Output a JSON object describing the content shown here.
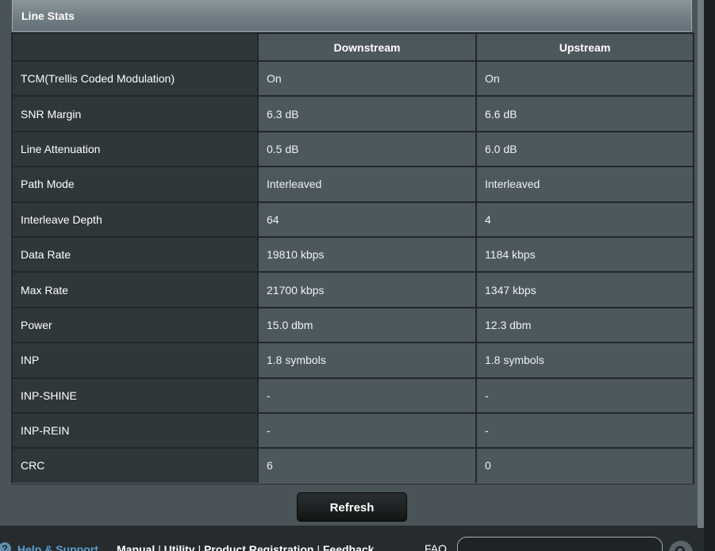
{
  "section": {
    "title": "Line Stats"
  },
  "table": {
    "headers": [
      "",
      "Downstream",
      "Upstream"
    ],
    "rows": [
      {
        "label": "TCM(Trellis Coded Modulation)",
        "down": "On",
        "up": "On"
      },
      {
        "label": "SNR Margin",
        "down": "6.3 dB",
        "up": "6.6 dB"
      },
      {
        "label": "Line Attenuation",
        "down": "0.5 dB",
        "up": "6.0 dB"
      },
      {
        "label": "Path Mode",
        "down": "Interleaved",
        "up": "Interleaved"
      },
      {
        "label": "Interleave Depth",
        "down": "64",
        "up": "4"
      },
      {
        "label": "Data Rate",
        "down": "19810 kbps",
        "up": "1184 kbps"
      },
      {
        "label": "Max Rate",
        "down": "21700 kbps",
        "up": "1347 kbps"
      },
      {
        "label": "Power",
        "down": "15.0 dbm",
        "up": "12.3 dbm"
      },
      {
        "label": "INP",
        "down": "1.8 symbols",
        "up": "1.8 symbols"
      },
      {
        "label": "INP-SHINE",
        "down": "-",
        "up": "-"
      },
      {
        "label": "INP-REIN",
        "down": "-",
        "up": "-"
      },
      {
        "label": "CRC",
        "down": "6",
        "up": "0"
      }
    ]
  },
  "actions": {
    "refresh_label": "Refresh"
  },
  "footer": {
    "help_icon": "?",
    "help_support": "Help & Support",
    "links": [
      "Manual",
      "Utility",
      "Product Registration",
      "Feedback"
    ],
    "link_separator": "|",
    "faq_label": "FAQ",
    "search_value": "",
    "search_icon": "search-icon"
  },
  "colors": {
    "panel": "#4a5357",
    "label_cell": "#2f373a",
    "value_cell": "#4d585d",
    "header_bar": "#707c82",
    "accent_link": "#5f9fcf"
  }
}
